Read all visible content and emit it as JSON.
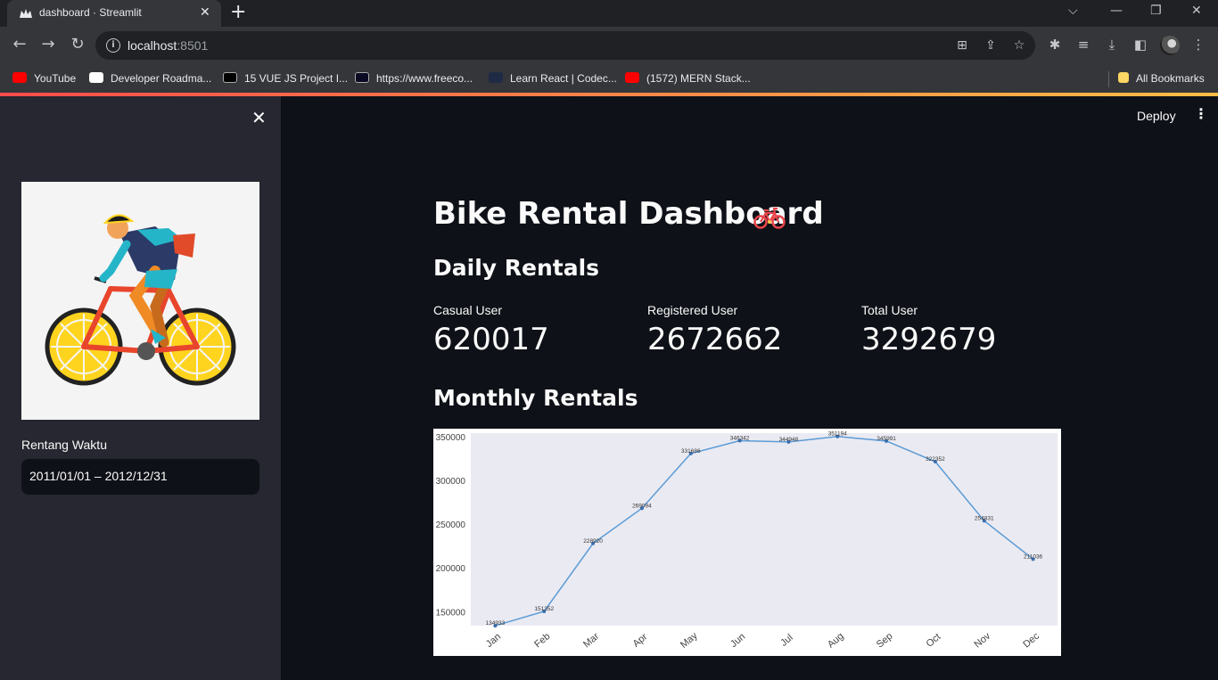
{
  "browser": {
    "tab_title": "dashboard · Streamlit",
    "url_host": "localhost",
    "url_port": ":8501",
    "bookmarks": [
      {
        "label": "YouTube",
        "icon": "youtube-icon",
        "color": "#ff0000"
      },
      {
        "label": "Developer Roadma...",
        "icon": "roadmap-icon",
        "color": "#ffffff"
      },
      {
        "label": "15 VUE JS Project I...",
        "icon": "dev-icon",
        "color": "#000000"
      },
      {
        "label": "https://www.freeco...",
        "icon": "freecodecamp-icon",
        "color": "#0a0a23"
      },
      {
        "label": "Learn React | Codec...",
        "icon": "codecademy-icon",
        "color": "#1f2a44"
      },
      {
        "label": "(1572) MERN Stack...",
        "icon": "youtube-icon",
        "color": "#ff0000"
      }
    ],
    "all_bookmarks": "All Bookmarks"
  },
  "sidebar": {
    "date_label": "Rentang Waktu",
    "date_value": "2011/01/01 – 2012/12/31"
  },
  "header": {
    "deploy": "Deploy"
  },
  "main": {
    "title": "Bike Rental Dashboard",
    "daily_heading": "Daily Rentals",
    "monthly_heading": "Monthly Rentals",
    "metrics": [
      {
        "label": "Casual User",
        "value": "620017"
      },
      {
        "label": "Registered User",
        "value": "2672662"
      },
      {
        "label": "Total User",
        "value": "3292679"
      }
    ]
  },
  "chart_data": {
    "type": "line",
    "categories": [
      "Jan",
      "Feb",
      "Mar",
      "Apr",
      "May",
      "Jun",
      "Jul",
      "Aug",
      "Sep",
      "Oct",
      "Nov",
      "Dec"
    ],
    "values": [
      134933,
      151352,
      228920,
      269094,
      331686,
      346342,
      344948,
      351194,
      345991,
      322352,
      254831,
      211036
    ],
    "ylim": [
      135000,
      355000
    ],
    "yticks": [
      150000,
      200000,
      250000,
      300000,
      350000
    ],
    "grid": false,
    "colors": {
      "line": "#5b9bd5",
      "background": "#eaeaf2"
    }
  }
}
